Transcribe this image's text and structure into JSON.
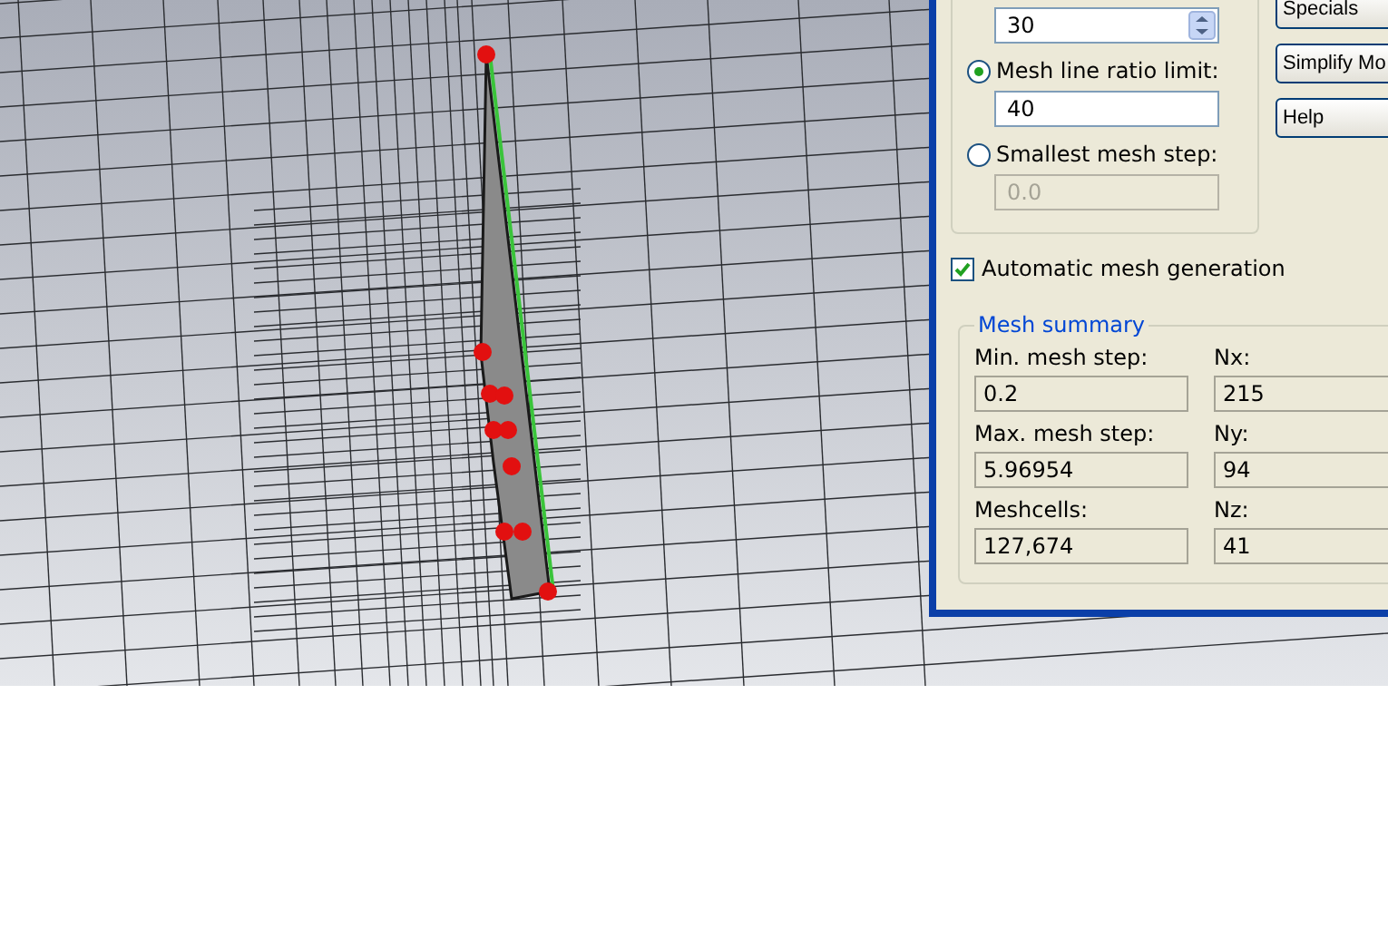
{
  "mesh_dialog": {
    "spinner_value": "30",
    "options": [
      {
        "label": "Mesh line ratio limit:",
        "value": "40",
        "selected": true
      },
      {
        "label": "Smallest mesh step:",
        "value": "0.0",
        "selected": false
      }
    ],
    "auto_mesh": {
      "label": "Automatic mesh generation",
      "checked": true
    },
    "summary": {
      "title": "Mesh summary",
      "items": [
        {
          "label": "Min. mesh step:",
          "value": "0.2"
        },
        {
          "label": "Nx:",
          "value": "215"
        },
        {
          "label": "Max. mesh step:",
          "value": "5.96954"
        },
        {
          "label": "Ny:",
          "value": "94"
        },
        {
          "label": "Meshcells:",
          "value": "127,674"
        },
        {
          "label": "Nz:",
          "value": "41"
        }
      ]
    },
    "buttons": [
      "Specials",
      "Simplify Mo",
      "Help"
    ]
  }
}
